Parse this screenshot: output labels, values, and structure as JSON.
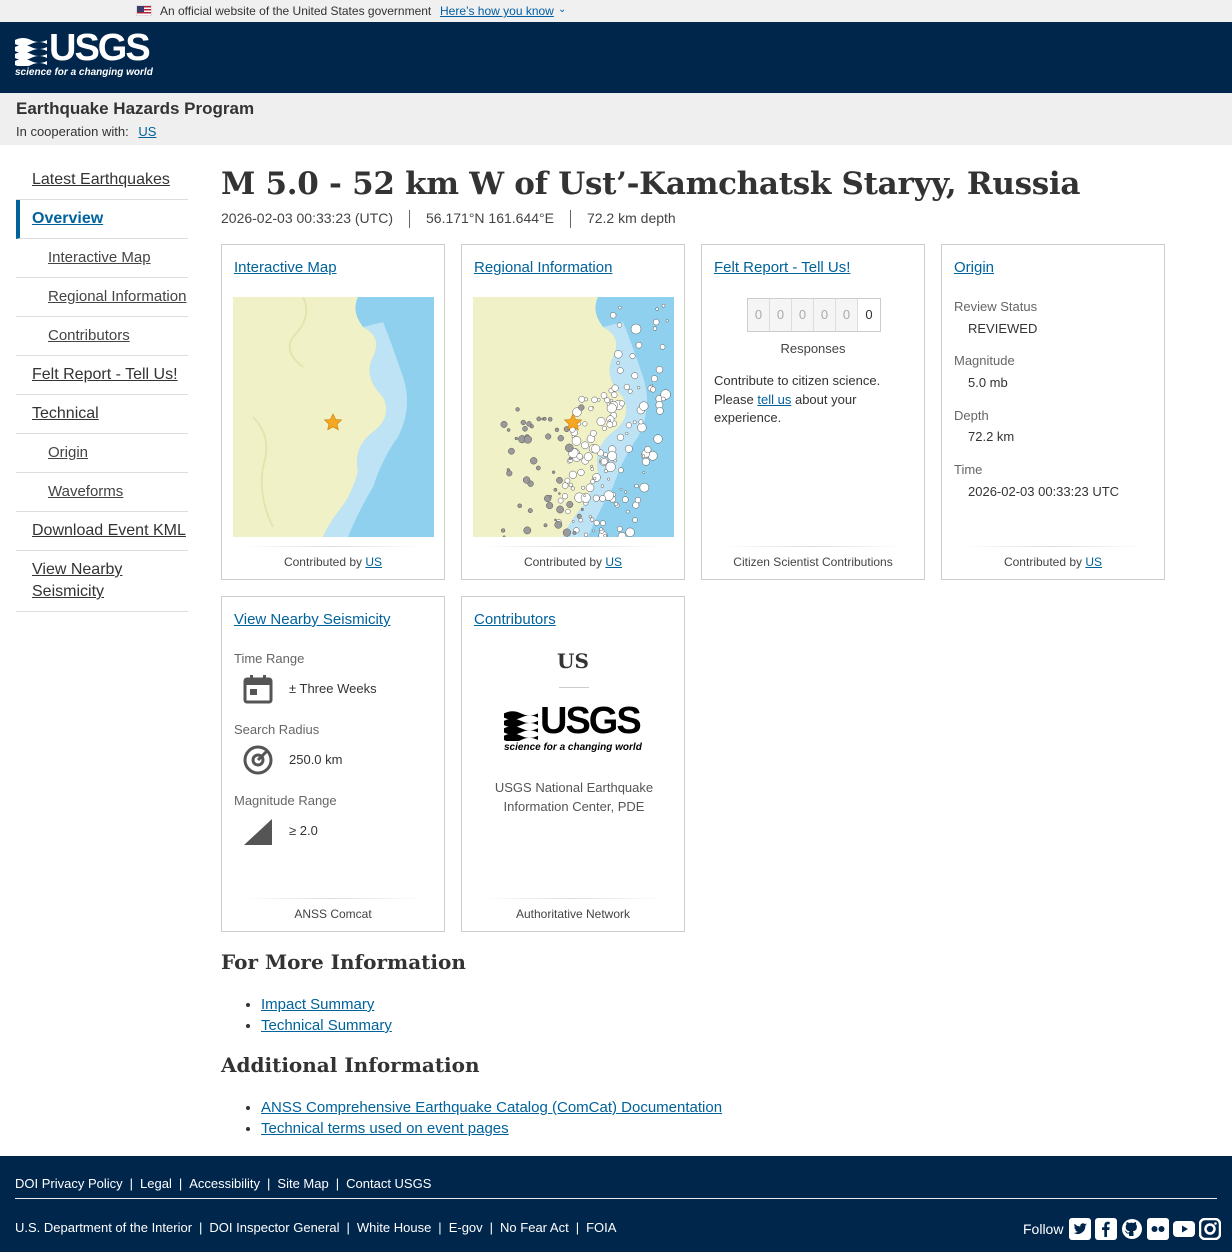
{
  "gov_banner": {
    "official_text": "An official website of the United States government",
    "how_link": "Here’s how you know"
  },
  "header": {
    "logo_word": "USGS",
    "logo_tagline": "science for a changing world"
  },
  "program": {
    "name": "Earthquake Hazards Program",
    "coop_label": "In cooperation with:",
    "coop_link": "US"
  },
  "sidebar": {
    "items": [
      {
        "label": "Latest Earthquakes"
      },
      {
        "label": "Overview"
      },
      {
        "label": "Interactive Map"
      },
      {
        "label": "Regional Information"
      },
      {
        "label": "Contributors"
      },
      {
        "label": "Felt Report - Tell Us!"
      },
      {
        "label": "Technical"
      },
      {
        "label": "Origin"
      },
      {
        "label": "Waveforms"
      },
      {
        "label": "Download Event KML"
      },
      {
        "label": "View Nearby Seismicity"
      }
    ]
  },
  "event": {
    "title": "M 5.0 - 52 km W of Ust’-Kamchatsk Staryy, Russia",
    "time": "2026-02-03 00:33:23 (UTC)",
    "location": "56.171°N 161.644°E",
    "depth": "72.2 km depth"
  },
  "cards": {
    "interactive_map": {
      "title": "Interactive Map",
      "contrib_prefix": "Contributed by",
      "contrib_link": "US"
    },
    "regional": {
      "title": "Regional Information",
      "contrib_prefix": "Contributed by",
      "contrib_link": "US"
    },
    "felt": {
      "title": "Felt Report - Tell Us!",
      "digits": [
        "0",
        "0",
        "0",
        "0",
        "0",
        "0"
      ],
      "responses_label": "Responses",
      "text_a": "Contribute to citizen science.",
      "text_b": "Please",
      "link": "tell us",
      "text_c": "about your experience.",
      "footer": "Citizen Scientist Contributions"
    },
    "origin": {
      "title": "Origin",
      "review_label": "Review Status",
      "review_value": "REVIEWED",
      "magnitude_label": "Magnitude",
      "magnitude_value": "5.0 mb",
      "depth_label": "Depth",
      "depth_value": "72.2 km",
      "time_label": "Time",
      "time_value": "2026-02-03 00:33:23 UTC",
      "contrib_prefix": "Contributed by",
      "contrib_link": "US"
    },
    "seismicity": {
      "title": "View Nearby Seismicity",
      "time_label": "Time Range",
      "time_value": "± Three Weeks",
      "radius_label": "Search Radius",
      "radius_value": "250.0 km",
      "mag_label": "Magnitude Range",
      "mag_value": "≥ 2.0",
      "footer": "ANSS Comcat"
    },
    "contributors": {
      "title": "Contributors",
      "network": "US",
      "logo_word": "USGS",
      "logo_tagline": "science for a changing world",
      "description": "USGS National Earthquake Information Center, PDE",
      "footer": "Authoritative Network"
    }
  },
  "more_info": {
    "heading": "For More Information",
    "links": [
      "Impact Summary",
      "Technical Summary"
    ]
  },
  "additional": {
    "heading": "Additional Information",
    "links": [
      "ANSS Comprehensive Earthquake Catalog (ComCat) Documentation",
      "Technical terms used on event pages"
    ]
  },
  "footer": {
    "row1": [
      "DOI Privacy Policy",
      "Legal",
      "Accessibility",
      "Site Map",
      "Contact USGS"
    ],
    "row2": [
      "U.S. Department of the Interior",
      "DOI Inspector General",
      "White House",
      "E-gov",
      "No Fear Act",
      "FOIA"
    ],
    "follow": "Follow",
    "socials": [
      "twitter-icon",
      "facebook-icon",
      "github-icon",
      "flickr-icon",
      "youtube-icon",
      "instagram-icon"
    ]
  },
  "colors": {
    "header": "#00264c",
    "link": "#00629b",
    "star": "#f5a623",
    "land": "#f1f1c8",
    "water": "#7fc6e8"
  }
}
